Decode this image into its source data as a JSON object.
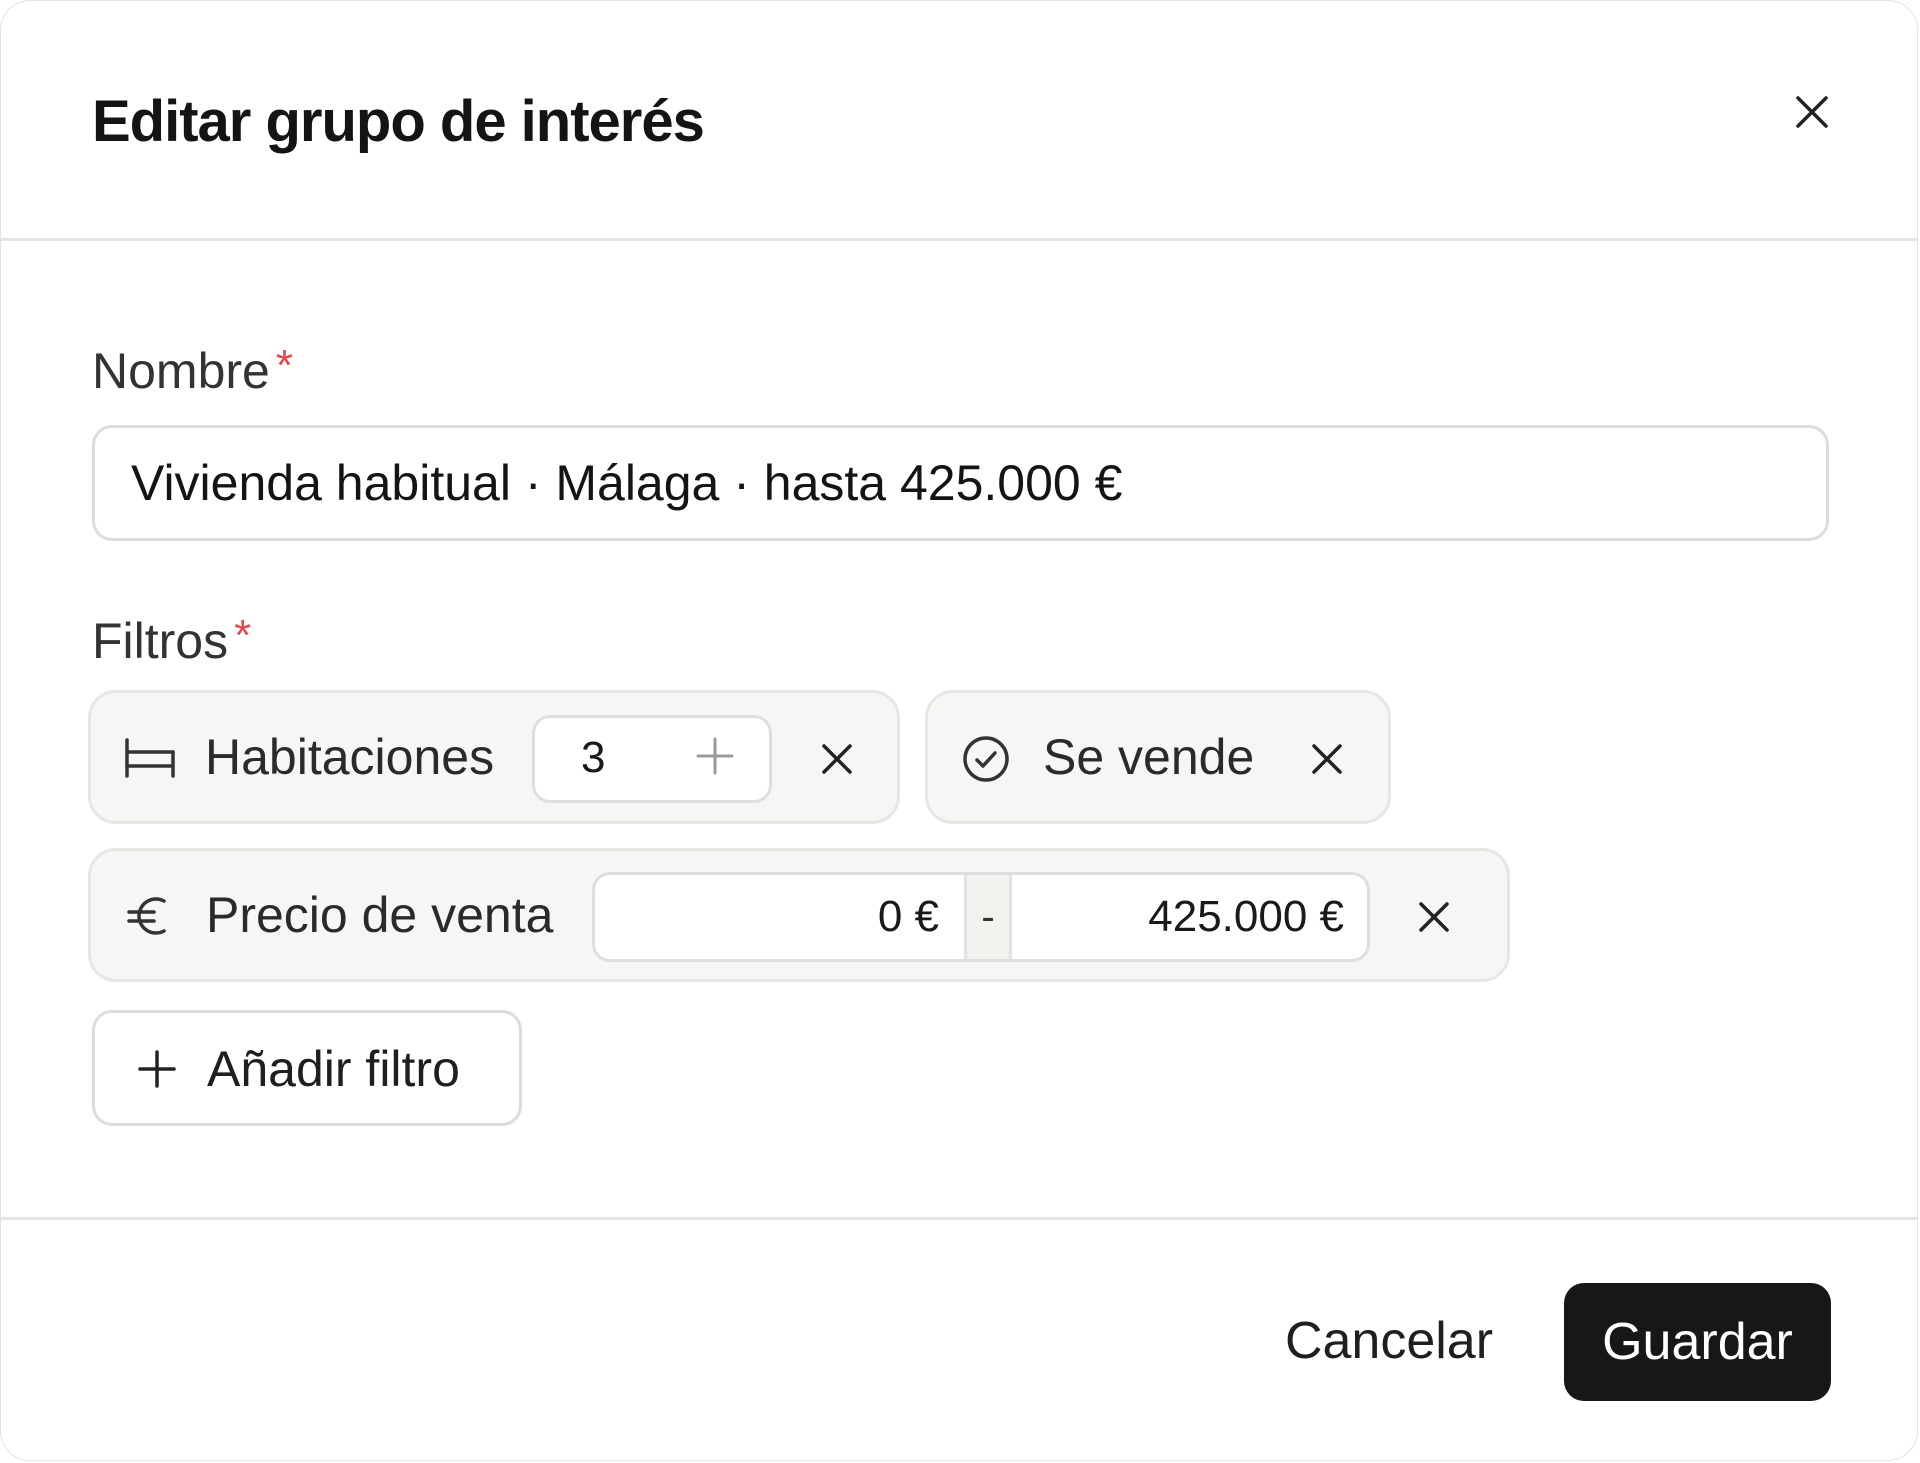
{
  "dialog": {
    "title": "Editar grupo de interés",
    "close_icon": "close-icon"
  },
  "form": {
    "name_label": "Nombre",
    "name_required": "*",
    "name_value": "Vivienda habitual · Málaga · hasta 425.000 €",
    "filters_label": "Filtros",
    "filters_required": "*"
  },
  "filters": {
    "rooms": {
      "icon": "bed-icon",
      "label": "Habitaciones",
      "value": "3",
      "stepper_icon": "plus-icon"
    },
    "status": {
      "icon": "check-circle-icon",
      "label": "Se vende"
    },
    "price": {
      "icon": "euro-icon",
      "label": "Precio de venta",
      "min": "0 €",
      "separator": "-",
      "max": "425.000 €"
    },
    "add_label": "Añadir filtro"
  },
  "footer": {
    "cancel_label": "Cancelar",
    "save_label": "Guardar"
  },
  "colors": {
    "primary": "#171717",
    "required": "#e5484d",
    "chip_bg": "#f6f6f4"
  }
}
